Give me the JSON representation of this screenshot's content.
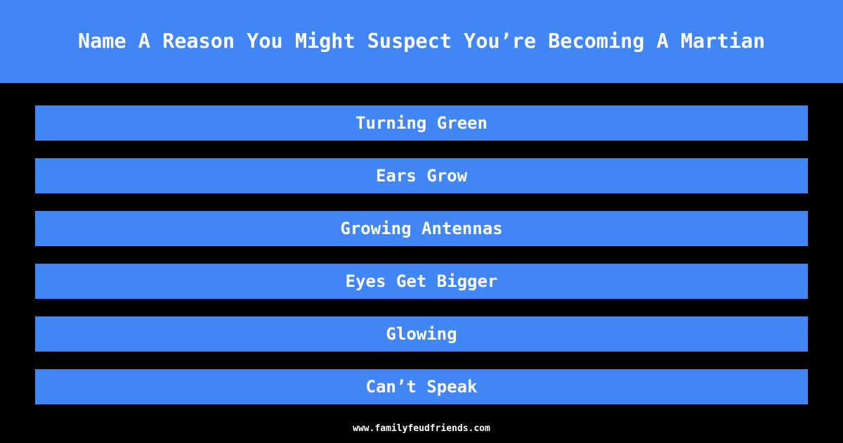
{
  "page": {
    "background_color": "#000000",
    "accent_color": "#4285F4",
    "text_color": "#FFFFFF"
  },
  "header": {
    "title": "Name A Reason You Might Suspect You’re Becoming A Martian"
  },
  "answers": [
    {
      "rank": 1,
      "text": "Turning Green"
    },
    {
      "rank": 2,
      "text": "Ears Grow"
    },
    {
      "rank": 3,
      "text": "Growing Antennas"
    },
    {
      "rank": 4,
      "text": "Eyes Get Bigger"
    },
    {
      "rank": 5,
      "text": "Glowing"
    },
    {
      "rank": 6,
      "text": "Can’t Speak"
    }
  ],
  "footer": {
    "url": "www.familyfeudfriends.com"
  }
}
